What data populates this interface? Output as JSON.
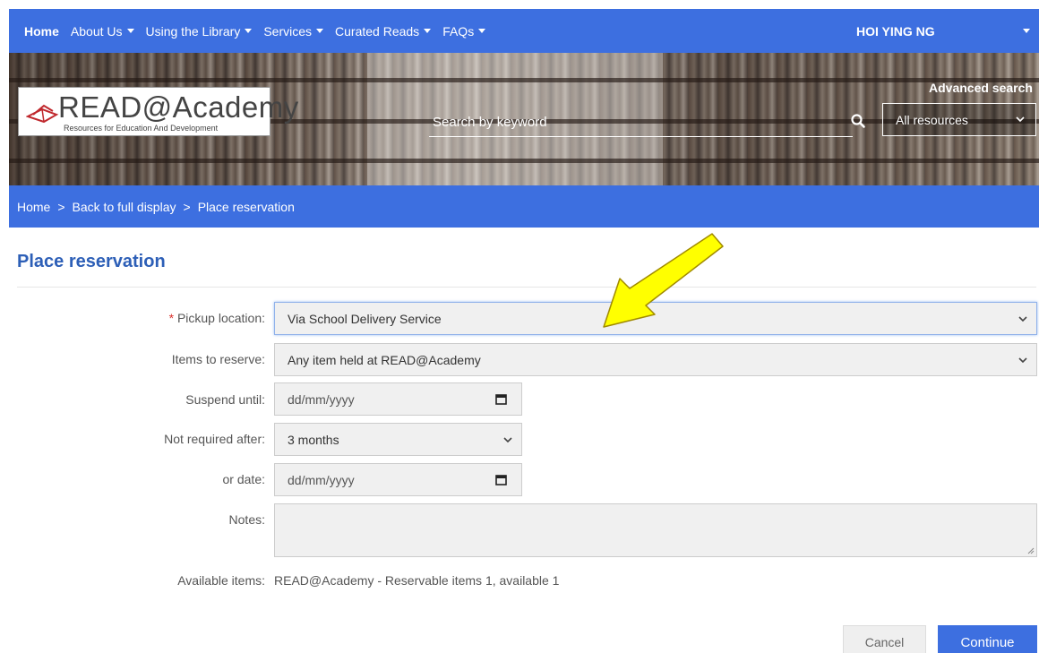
{
  "nav": {
    "items": [
      {
        "label": "Home",
        "dropdown": false
      },
      {
        "label": "About Us",
        "dropdown": true
      },
      {
        "label": "Using the Library",
        "dropdown": true
      },
      {
        "label": "Services",
        "dropdown": true
      },
      {
        "label": "Curated Reads",
        "dropdown": true
      },
      {
        "label": "FAQs",
        "dropdown": true
      }
    ],
    "user": "HOI YING NG"
  },
  "banner": {
    "logo_main": "READ@Academy",
    "logo_sub": "Resources for Education And Development",
    "search_placeholder": "Search by keyword",
    "scope_selected": "All resources",
    "advanced_search": "Advanced search"
  },
  "breadcrumb": [
    "Home",
    "Back to full display",
    "Place reservation"
  ],
  "page_title": "Place reservation",
  "form": {
    "pickup": {
      "label": "Pickup location:",
      "required_mark": "*",
      "value": "Via School Delivery Service"
    },
    "items": {
      "label": "Items to reserve:",
      "value": "Any item held at READ@Academy"
    },
    "suspend": {
      "label": "Suspend until:",
      "placeholder": "dd/mm/yyyy"
    },
    "not_required": {
      "label": "Not required after:",
      "value": "3 months"
    },
    "or_date": {
      "label": "or date:",
      "placeholder": "dd/mm/yyyy"
    },
    "notes": {
      "label": "Notes:",
      "value": ""
    },
    "available": {
      "label": "Available items:",
      "value": "READ@Academy - Reservable items 1, available 1"
    }
  },
  "buttons": {
    "cancel": "Cancel",
    "continue": "Continue"
  },
  "colors": {
    "primary": "#3d6fe0",
    "title": "#2d5fb7",
    "annotation_arrow": "#ffff00"
  }
}
